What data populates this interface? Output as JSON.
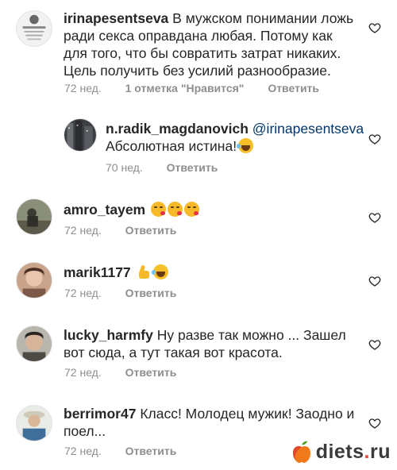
{
  "comments": [
    {
      "username": "irinapesentseva",
      "text": "В мужском понимании ложь ради секса оправдана любая. Потому как для того, что бы совратить затрат никаких. Цель получить без усилий разнообразие.",
      "time": "72 нед.",
      "likes": "1 отметка \"Нравится\"",
      "reply": "Ответить"
    },
    {
      "username": "n.radik_magdanovich",
      "mention": "@irinapesentseva",
      "text": "Абсолютная истина!",
      "emoji": [
        "laugh"
      ],
      "time": "70 нед.",
      "reply": "Ответить"
    },
    {
      "username": "amro_tayem",
      "text": "",
      "emoji": [
        "kiss",
        "kiss",
        "kiss"
      ],
      "time": "72 нед.",
      "reply": "Ответить"
    },
    {
      "username": "marik1177",
      "text": "",
      "emoji": [
        "thumbs-up",
        "laugh"
      ],
      "time": "72 нед.",
      "reply": "Ответить"
    },
    {
      "username": "lucky_harmfy",
      "text": "Ну разве так можно ... Зашел вот сюда, а тут такая вот красота.",
      "time": "72 нед.",
      "reply": "Ответить"
    },
    {
      "username": "berrimor47",
      "text": "Класс! Молодец мужик! Заодно и поел...",
      "time": "72 нед.",
      "reply": "Ответить"
    }
  ],
  "watermark": {
    "name": "diets",
    "dot": ".",
    "tld": "ru"
  },
  "colors": {
    "text": "#262626",
    "meta": "#8e8e8e",
    "mention": "#003569",
    "watermark_accent": "#e2462e"
  },
  "icons": {
    "like": "heart-outline-icon"
  }
}
